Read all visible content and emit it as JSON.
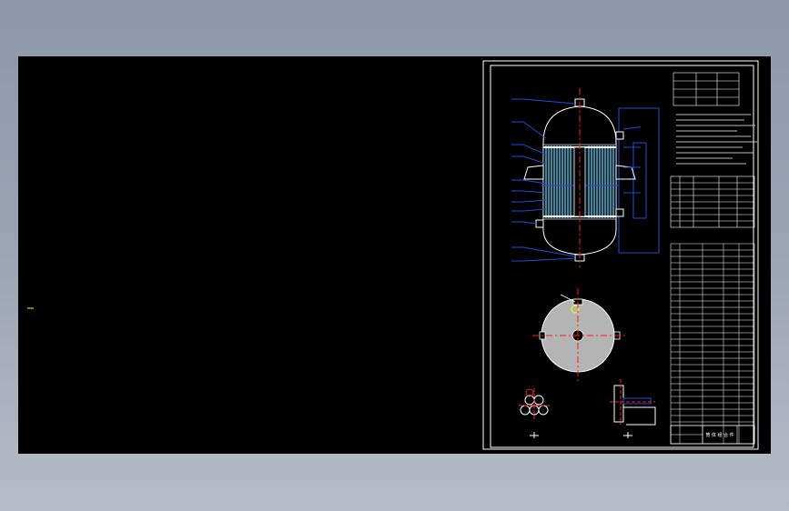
{
  "colors": {
    "canvas": "#000000",
    "frame": "#ffffff",
    "centerline": "#ff2020",
    "leader": "#1e4bd8",
    "tube": "#7fd6e6",
    "disc": "#b4b4b4",
    "marker": "#ffff00"
  },
  "icons": {
    "ucs_marker": "ucs-marker-icon"
  },
  "drawing": {
    "title_block": {
      "text": "筒 体 组 合 件"
    }
  }
}
